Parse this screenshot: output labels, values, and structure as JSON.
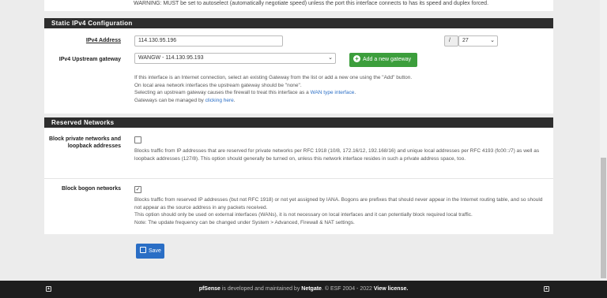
{
  "top_warning": "WARNING: MUST be set to autoselect (automatically negotiate speed) unless the port this interface connects to has its speed and duplex forced.",
  "ipv4_section": {
    "title": "Static IPv4 Configuration",
    "address_label": "IPv4 Address",
    "address_value": "114.130.95.196",
    "cidr_separator": "/",
    "cidr_value": "27",
    "gateway_label": "IPv4 Upstream gateway",
    "gateway_value": "WANGW - 114.130.95.193",
    "add_gateway_button": "Add a new gateway",
    "help_line1": "If this interface is an Internet connection, select an existing Gateway from the list or add a new one using the \"Add\" button.",
    "help_line2": "On local area network interfaces the upstream gateway should be \"none\".",
    "help_line3_prefix": "Selecting an upstream gateway causes the firewall to treat this interface as a ",
    "help_line3_link": "WAN type interface",
    "help_line3_suffix": ".",
    "help_line4_prefix": "Gateways can be managed by ",
    "help_line4_link": "clicking here",
    "help_line4_suffix": "."
  },
  "reserved_section": {
    "title": "Reserved Networks",
    "private_label": "Block private networks and loopback addresses",
    "private_checked": false,
    "private_help": "Blocks traffic from IP addresses that are reserved for private networks per RFC 1918 (10/8, 172.16/12, 192.168/16) and unique local addresses per RFC 4193 (fc00::/7) as well as loopback addresses (127/8). This option should generally be turned on, unless this network interface resides in such a private address space, too.",
    "bogon_label": "Block bogon networks",
    "bogon_checked": true,
    "bogon_help1": "Blocks traffic from reserved IP addresses (but not RFC 1918) or not yet assigned by IANA. Bogons are prefixes that should never appear in the Internet routing table, and so should not appear as the source address in any packets received.",
    "bogon_help2": "This option should only be used on external interfaces (WANs), it is not necessary on local interfaces and it can potentially block required local traffic.",
    "bogon_help3": "Note: The update frequency can be changed under System > Advanced, Firewall & NAT settings."
  },
  "save_button": "Save",
  "footer": {
    "brand": "pfSense",
    "text1": " is developed and maintained by ",
    "company": "Netgate",
    "text2": ". © ESF 2004 - 2022 ",
    "license": "View license."
  }
}
